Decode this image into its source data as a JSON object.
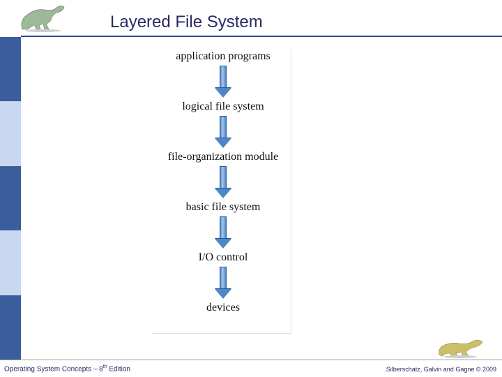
{
  "title": "Layered File System",
  "layers": {
    "l0": "application programs",
    "l1": "logical file system",
    "l2": "file-organization module",
    "l3": "basic file system",
    "l4": "I/O control",
    "l5": "devices"
  },
  "footer": {
    "left_prefix": "Operating System Concepts – 8",
    "left_ordinal": "th",
    "left_suffix": " Edition",
    "right": "Silberschatz, Galvin and Gagne © 2009"
  },
  "icons": {
    "top_logo": "dinosaur-icon",
    "bottom_logo": "dinosaur-icon"
  }
}
